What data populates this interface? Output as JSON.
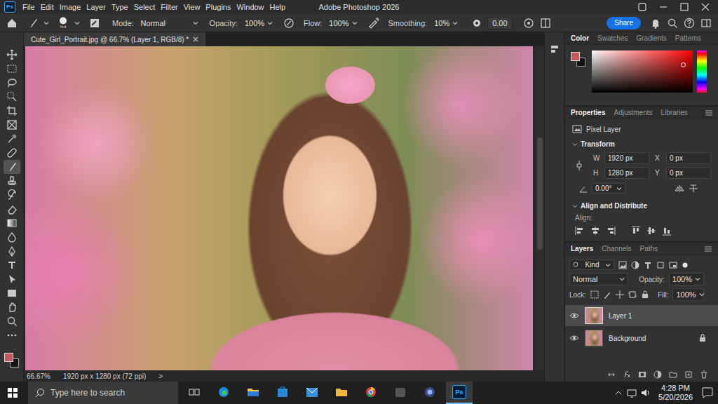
{
  "app": {
    "logo": "Ps",
    "title": "Adobe Photoshop 2026"
  },
  "menu": [
    "File",
    "Edit",
    "Image",
    "Layer",
    "Type",
    "Select",
    "Filter",
    "View",
    "Plugins",
    "Window",
    "Help"
  ],
  "options_bar": {
    "brush_size": "hrd",
    "mode_label": "Mode:",
    "mode": "Normal",
    "opacity_label": "Opacity:",
    "opacity": "100%",
    "flow_label": "Flow:",
    "flow": "100%",
    "smoothing_label": "Smoothing:",
    "smoothing": "10%",
    "angle": "0.00",
    "share": "Share"
  },
  "document_tab": {
    "title": "Cute_Girl_Portrait.jpg @ 66.7% (Layer 1, RGB/8) *",
    "selected": true
  },
  "tools": [
    {
      "selected": false
    },
    {
      "selected": false
    },
    {
      "selected": false
    },
    {
      "selected": false
    },
    {
      "selected": false
    },
    {
      "selected": false
    },
    {
      "selected": false
    },
    {
      "selected": false
    },
    {
      "selected": true
    },
    {
      "selected": false
    },
    {
      "selected": false
    },
    {
      "selected": false
    },
    {
      "selected": false
    },
    {
      "selected": false
    },
    {
      "selected": false
    },
    {
      "selected": false
    },
    {
      "selected": false
    },
    {
      "selected": false
    },
    {
      "selected": false
    },
    {
      "selected": false
    },
    {
      "selected": false
    }
  ],
  "colors": {
    "foreground": "#c9545a",
    "background": "#141414"
  },
  "status_bar": {
    "zoom": "66.67%",
    "document_size": "1920 px x 1280 px (72 ppi)",
    "arrow": ">"
  },
  "color_panel": {
    "tabs": [
      {
        "label": "Color",
        "selected": true
      },
      {
        "label": "Swatches",
        "selected": false
      },
      {
        "label": "Gradients",
        "selected": false
      },
      {
        "label": "Patterns",
        "selected": false
      }
    ]
  },
  "properties_panel": {
    "tabs": [
      {
        "label": "Properties",
        "selected": true
      },
      {
        "label": "Adjustments",
        "selected": false
      },
      {
        "label": "Libraries",
        "selected": false
      }
    ],
    "layer_kind": "Pixel Layer",
    "transform_title": "Transform",
    "fields": [
      {
        "label": "W",
        "value": "1920 px"
      },
      {
        "label": "X",
        "value": "0 px"
      },
      {
        "label": "H",
        "value": "1280 px"
      },
      {
        "label": "Y",
        "value": "0 px"
      }
    ],
    "angle": "0.00°",
    "align_title": "Align and Distribute",
    "align_label": "Align:"
  },
  "layers_panel": {
    "tabs": [
      {
        "label": "Layers",
        "selected": true
      },
      {
        "label": "Channels",
        "selected": false
      },
      {
        "label": "Paths",
        "selected": false
      }
    ],
    "filter": "Kind",
    "blend_mode": "Normal",
    "opacity_label": "Opacity:",
    "opacity": "100%",
    "lock_label": "Lock:",
    "fill_label": "Fill:",
    "fill": "100%",
    "layers": [
      {
        "name": "Layer 1",
        "selected": true,
        "visible": true,
        "locked": false
      },
      {
        "name": "Background",
        "selected": false,
        "visible": true,
        "locked": true
      }
    ]
  },
  "taskbar": {
    "search": "Type here to search",
    "time": "4:28 PM",
    "date": "5/20/2026",
    "apps": [
      {
        "selected": false
      },
      {
        "selected": false
      },
      {
        "selected": false
      },
      {
        "selected": false
      },
      {
        "selected": false
      },
      {
        "selected": false
      },
      {
        "selected": false
      },
      {
        "selected": false
      },
      {
        "selected": false
      },
      {
        "selected": true
      }
    ]
  }
}
